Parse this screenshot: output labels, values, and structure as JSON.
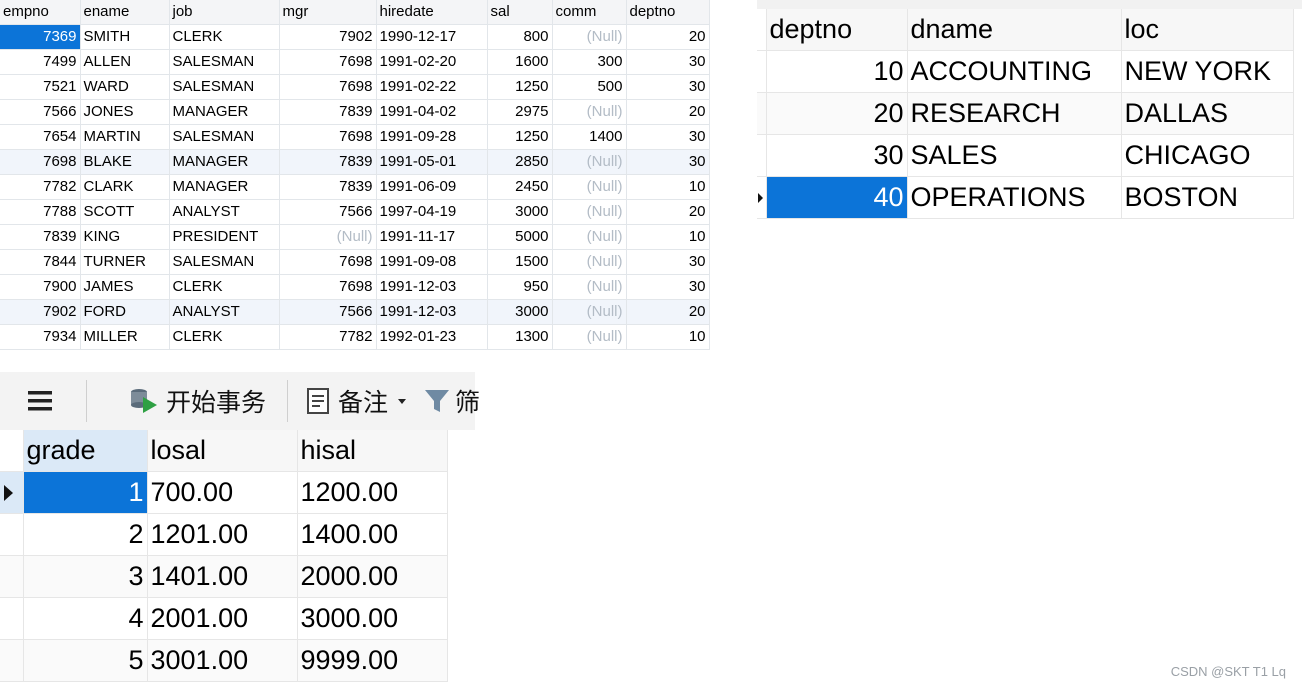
{
  "emp": {
    "columns": [
      "empno",
      "ename",
      "job",
      "mgr",
      "hiredate",
      "sal",
      "comm",
      "deptno"
    ],
    "rows": [
      [
        "7369",
        "SMITH",
        "CLERK",
        "7902",
        "1990-12-17",
        "800",
        "(Null)",
        "20"
      ],
      [
        "7499",
        "ALLEN",
        "SALESMAN",
        "7698",
        "1991-02-20",
        "1600",
        "300",
        "30"
      ],
      [
        "7521",
        "WARD",
        "SALESMAN",
        "7698",
        "1991-02-22",
        "1250",
        "500",
        "30"
      ],
      [
        "7566",
        "JONES",
        "MANAGER",
        "7839",
        "1991-04-02",
        "2975",
        "(Null)",
        "20"
      ],
      [
        "7654",
        "MARTIN",
        "SALESMAN",
        "7698",
        "1991-09-28",
        "1250",
        "1400",
        "30"
      ],
      [
        "7698",
        "BLAKE",
        "MANAGER",
        "7839",
        "1991-05-01",
        "2850",
        "(Null)",
        "30"
      ],
      [
        "7782",
        "CLARK",
        "MANAGER",
        "7839",
        "1991-06-09",
        "2450",
        "(Null)",
        "10"
      ],
      [
        "7788",
        "SCOTT",
        "ANALYST",
        "7566",
        "1997-04-19",
        "3000",
        "(Null)",
        "20"
      ],
      [
        "7839",
        "KING",
        "PRESIDENT",
        "(Null)",
        "1991-11-17",
        "5000",
        "(Null)",
        "10"
      ],
      [
        "7844",
        "TURNER",
        "SALESMAN",
        "7698",
        "1991-09-08",
        "1500",
        "(Null)",
        "30"
      ],
      [
        "7900",
        "JAMES",
        "CLERK",
        "7698",
        "1991-12-03",
        "950",
        "(Null)",
        "30"
      ],
      [
        "7902",
        "FORD",
        "ANALYST",
        "7566",
        "1991-12-03",
        "3000",
        "(Null)",
        "20"
      ],
      [
        "7934",
        "MILLER",
        "CLERK",
        "7782",
        "1992-01-23",
        "1300",
        "(Null)",
        "10"
      ]
    ]
  },
  "dept": {
    "columns": [
      "deptno",
      "dname",
      "loc"
    ],
    "rows": [
      [
        "10",
        "ACCOUNTING",
        "NEW YORK"
      ],
      [
        "20",
        "RESEARCH",
        "DALLAS"
      ],
      [
        "30",
        "SALES",
        "CHICAGO"
      ],
      [
        "40",
        "OPERATIONS",
        "BOSTON"
      ]
    ]
  },
  "toolbar": {
    "begin_transaction": "开始事务",
    "note": "备注",
    "filter": "筛"
  },
  "salgrade": {
    "columns": [
      "grade",
      "losal",
      "hisal"
    ],
    "rows": [
      [
        "1",
        "700.00",
        "1200.00"
      ],
      [
        "2",
        "1201.00",
        "1400.00"
      ],
      [
        "3",
        "1401.00",
        "2000.00"
      ],
      [
        "4",
        "2001.00",
        "3000.00"
      ],
      [
        "5",
        "3001.00",
        "9999.00"
      ]
    ]
  },
  "watermark": "CSDN @SKT T1 Lq",
  "colors": {
    "selection": "#0c74d8",
    "null_text": "#b3bcc6",
    "header_bg": "#f7f7f7"
  }
}
